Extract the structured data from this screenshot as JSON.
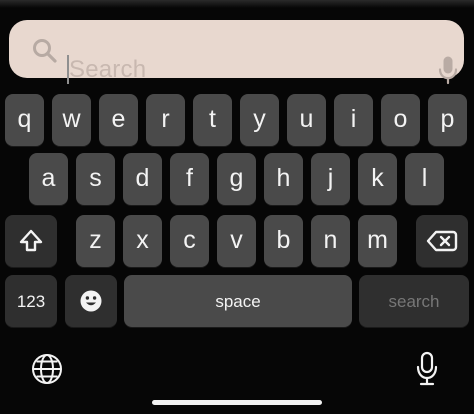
{
  "search": {
    "placeholder": "Search",
    "search_icon": "search-icon",
    "mic_icon": "mic-icon"
  },
  "keyboard": {
    "row1": [
      "q",
      "w",
      "e",
      "r",
      "t",
      "y",
      "u",
      "i",
      "o",
      "p"
    ],
    "row2": [
      "a",
      "s",
      "d",
      "f",
      "g",
      "h",
      "j",
      "k",
      "l"
    ],
    "row3": [
      "z",
      "x",
      "c",
      "v",
      "b",
      "n",
      "m"
    ],
    "bottom": {
      "numbers": "123",
      "space": "space",
      "search": "search"
    },
    "icons": {
      "shift": "shift-icon",
      "delete": "delete-icon",
      "emoji": "emoji-icon",
      "globe": "globe-icon",
      "dictation": "dictation-mic-icon"
    }
  },
  "colors": {
    "background": "#060606",
    "key": "#4a4a4a",
    "dark_key": "#2f2f2f",
    "search_field": "#e8d8cf",
    "text": "#f3f3f3"
  }
}
